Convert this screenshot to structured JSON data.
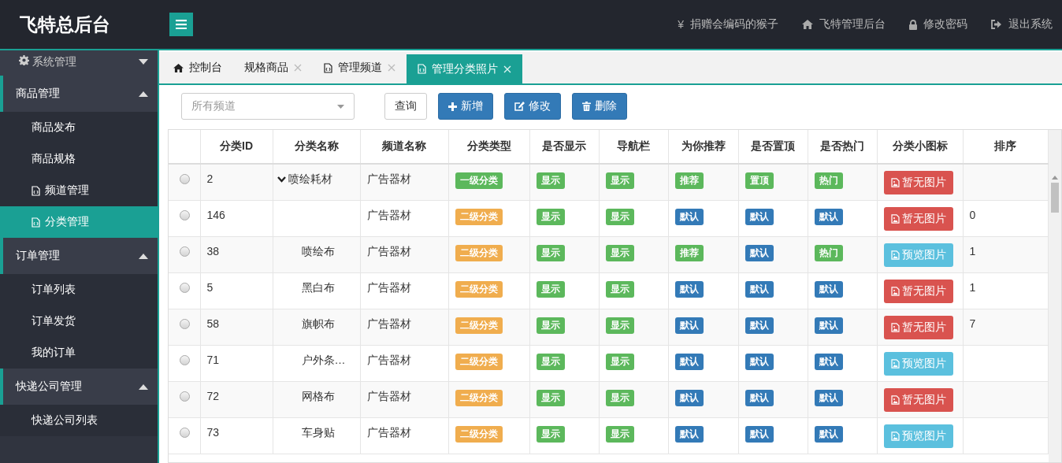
{
  "brand": "飞特总后台",
  "header_links": [
    {
      "kind": "yen",
      "glyph": "¥",
      "label": "捐赠会编码的猴子"
    },
    {
      "kind": "home",
      "label": "飞特管理后台"
    },
    {
      "kind": "lock",
      "label": "修改密码"
    },
    {
      "kind": "exit",
      "label": "退出系统"
    }
  ],
  "sidebar": [
    {
      "label": "系统管理",
      "kind": "gear",
      "expanded": false
    },
    {
      "label": "商品管理",
      "kind": "plain",
      "expanded": true,
      "children": [
        {
          "label": "商品发布",
          "icon": false,
          "selected": false
        },
        {
          "label": "商品规格",
          "icon": false,
          "selected": false
        },
        {
          "label": "频道管理",
          "icon": true,
          "selected": false
        },
        {
          "label": "分类管理",
          "icon": true,
          "selected": true
        }
      ]
    },
    {
      "label": "订单管理",
      "kind": "plain",
      "expanded": true,
      "children": [
        {
          "label": "订单列表",
          "icon": false,
          "selected": false
        },
        {
          "label": "订单发货",
          "icon": false,
          "selected": false
        },
        {
          "label": "我的订单",
          "icon": false,
          "selected": false
        }
      ]
    },
    {
      "label": "快递公司管理",
      "kind": "plain",
      "expanded": true,
      "children": [
        {
          "label": "快递公司列表",
          "icon": false,
          "selected": false
        }
      ]
    }
  ],
  "tabs": [
    {
      "label": "控制台",
      "kind": "home",
      "closable": false,
      "selected": false
    },
    {
      "label": "规格商品",
      "kind": "none",
      "closable": true,
      "selected": false
    },
    {
      "label": "管理频道",
      "kind": "file",
      "closable": true,
      "selected": false
    },
    {
      "label": "管理分类照片",
      "kind": "file",
      "closable": true,
      "selected": true
    }
  ],
  "toolbar": {
    "channel_select": {
      "placeholder": "所有频道"
    },
    "buttons": [
      {
        "label": "查询",
        "kind": "query"
      },
      {
        "label": "新增",
        "kind": "add"
      },
      {
        "label": "修改",
        "kind": "edit"
      },
      {
        "label": "删除",
        "kind": "delete"
      }
    ]
  },
  "table": {
    "columns": [
      "分类ID",
      "分类名称",
      "频道名称",
      "分类类型",
      "是否显示",
      "导航栏",
      "为你推荐",
      "是否置顶",
      "是否热门",
      "分类小图标",
      "排序"
    ],
    "rows": [
      {
        "selected": false,
        "id": "2",
        "name": "喷绘耗材",
        "expanded": true,
        "channel": "广告器材",
        "badges": [
          {
            "text": "一级分类",
            "color": "#5cb85c"
          },
          {
            "text": "显示",
            "color": "#5cb85c"
          },
          {
            "text": "显示",
            "color": "#5cb85c"
          },
          {
            "text": "推荐",
            "color": "#5cb85c"
          },
          {
            "text": "置顶",
            "color": "#5cb85c"
          },
          {
            "text": "热门",
            "color": "#5cb85c"
          }
        ],
        "image": {
          "text": "暂无图片",
          "color": "#d9534f"
        },
        "children": [
          {
            "selected": false,
            "id": "146",
            "channel": "广告器材",
            "badges": [
              {
                "text": "二级分类",
                "color": "#f0ad4e"
              },
              {
                "text": "显示",
                "color": "#5cb85c"
              },
              {
                "text": "显示",
                "color": "#5cb85c"
              },
              {
                "text": "默认",
                "color": "#337ab7"
              },
              {
                "text": "默认",
                "color": "#337ab7"
              },
              {
                "text": "默认",
                "color": "#337ab7"
              }
            ],
            "image": {
              "text": "暂无图片",
              "color": "#d9534f"
            },
            "sort": "0"
          },
          {
            "selected": false,
            "id": "38",
            "name": "喷绘布",
            "channel": "广告器材",
            "badges": [
              {
                "text": "二级分类",
                "color": "#f0ad4e"
              },
              {
                "text": "显示",
                "color": "#5cb85c"
              },
              {
                "text": "显示",
                "color": "#5cb85c"
              },
              {
                "text": "推荐",
                "color": "#5cb85c"
              },
              {
                "text": "默认",
                "color": "#337ab7"
              },
              {
                "text": "热门",
                "color": "#5cb85c"
              }
            ],
            "image": {
              "text": "预览图片",
              "color": "#5bc0de"
            },
            "sort": "1"
          },
          {
            "selected": false,
            "id": "5",
            "name": "黑白布",
            "channel": "广告器材",
            "badges": [
              {
                "text": "二级分类",
                "color": "#f0ad4e"
              },
              {
                "text": "显示",
                "color": "#5cb85c"
              },
              {
                "text": "显示",
                "color": "#5cb85c"
              },
              {
                "text": "默认",
                "color": "#337ab7"
              },
              {
                "text": "默认",
                "color": "#337ab7"
              },
              {
                "text": "默认",
                "color": "#337ab7"
              }
            ],
            "image": {
              "text": "暂无图片",
              "color": "#d9534f"
            },
            "sort": "1"
          },
          {
            "selected": false,
            "id": "58",
            "name": "旗帜布",
            "channel": "广告器材",
            "badges": [
              {
                "text": "二级分类",
                "color": "#f0ad4e"
              },
              {
                "text": "显示",
                "color": "#5cb85c"
              },
              {
                "text": "显示",
                "color": "#5cb85c"
              },
              {
                "text": "默认",
                "color": "#337ab7"
              },
              {
                "text": "默认",
                "color": "#337ab7"
              },
              {
                "text": "默认",
                "color": "#337ab7"
              }
            ],
            "image": {
              "text": "暂无图片",
              "color": "#d9534f"
            },
            "sort": "7"
          },
          {
            "selected": false,
            "id": "71",
            "name": "户外条…",
            "channel": "广告器材",
            "badges": [
              {
                "text": "二级分类",
                "color": "#f0ad4e"
              },
              {
                "text": "显示",
                "color": "#5cb85c"
              },
              {
                "text": "显示",
                "color": "#5cb85c"
              },
              {
                "text": "默认",
                "color": "#337ab7"
              },
              {
                "text": "默认",
                "color": "#337ab7"
              },
              {
                "text": "默认",
                "color": "#337ab7"
              }
            ],
            "image": {
              "text": "预览图片",
              "color": "#5bc0de"
            }
          },
          {
            "selected": false,
            "id": "72",
            "name": "网格布",
            "channel": "广告器材",
            "badges": [
              {
                "text": "二级分类",
                "color": "#f0ad4e"
              },
              {
                "text": "显示",
                "color": "#5cb85c"
              },
              {
                "text": "显示",
                "color": "#5cb85c"
              },
              {
                "text": "默认",
                "color": "#337ab7"
              },
              {
                "text": "默认",
                "color": "#337ab7"
              },
              {
                "text": "默认",
                "color": "#337ab7"
              }
            ],
            "image": {
              "text": "暂无图片",
              "color": "#d9534f"
            }
          },
          {
            "selected": false,
            "id": "73",
            "name": "车身贴",
            "channel": "广告器材",
            "badges": [
              {
                "text": "二级分类",
                "color": "#f0ad4e"
              },
              {
                "text": "显示",
                "color": "#5cb85c"
              },
              {
                "text": "显示",
                "color": "#5cb85c"
              },
              {
                "text": "默认",
                "color": "#337ab7"
              },
              {
                "text": "默认",
                "color": "#337ab7"
              },
              {
                "text": "默认",
                "color": "#337ab7"
              }
            ],
            "image": {
              "text": "预览图片",
              "color": "#5bc0de"
            }
          }
        ]
      }
    ]
  }
}
